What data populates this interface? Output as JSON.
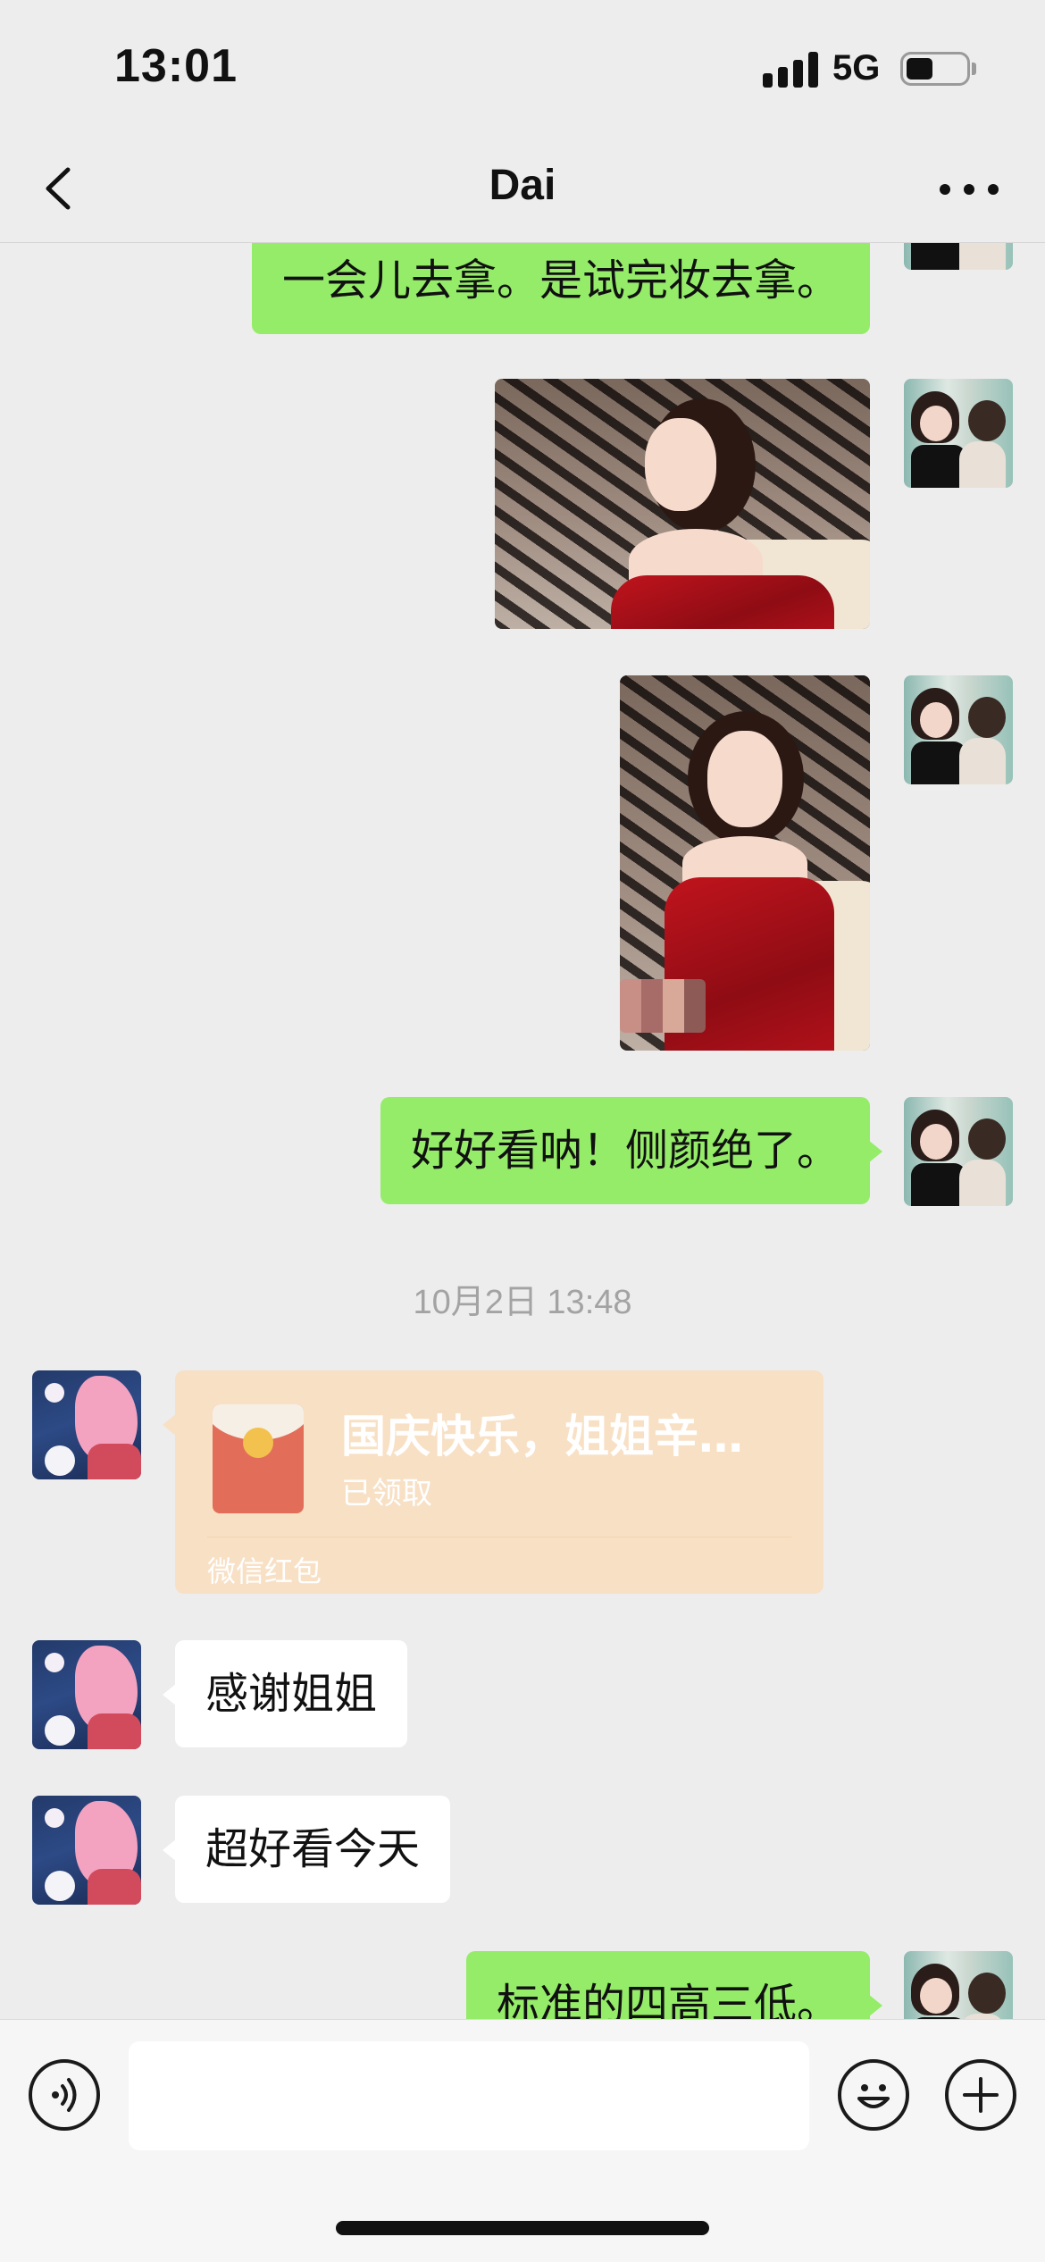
{
  "status_bar": {
    "time": "13:01",
    "network": "5G",
    "battery_level": 0.45,
    "signal_bars": 4
  },
  "nav": {
    "title": "Dai",
    "back_icon": "chevron-left-icon",
    "more_icon": "more-dots-icon"
  },
  "messages": [
    {
      "type": "text",
      "from": "self",
      "text": "一会儿去拿。是试完妆去拿。"
    },
    {
      "type": "image",
      "from": "self",
      "alt": "side profile photo in red dress"
    },
    {
      "type": "image",
      "from": "self",
      "alt": "portrait photo in red dress"
    },
    {
      "type": "text",
      "from": "self",
      "text": "好好看呐！侧颜绝了。"
    },
    {
      "type": "timestamp",
      "text": "10月2日 13:48"
    },
    {
      "type": "red_packet",
      "from": "other",
      "title": "国庆快乐，姐姐辛…",
      "status": "已领取",
      "label": "微信红包"
    },
    {
      "type": "text",
      "from": "other",
      "text": "感谢姐姐"
    },
    {
      "type": "text",
      "from": "other",
      "text": "超好看今天"
    },
    {
      "type": "text",
      "from": "self",
      "text": "标准的四高三低。"
    }
  ],
  "input_bar": {
    "voice_icon": "voice-icon",
    "emoji_icon": "emoji-icon",
    "plus_icon": "plus-icon",
    "value": ""
  },
  "colors": {
    "background": "#ededed",
    "self_bubble": "#95ec69",
    "other_bubble": "#ffffff",
    "red_packet": "#f8e0c5",
    "timestamp": "#a3a3a3"
  }
}
